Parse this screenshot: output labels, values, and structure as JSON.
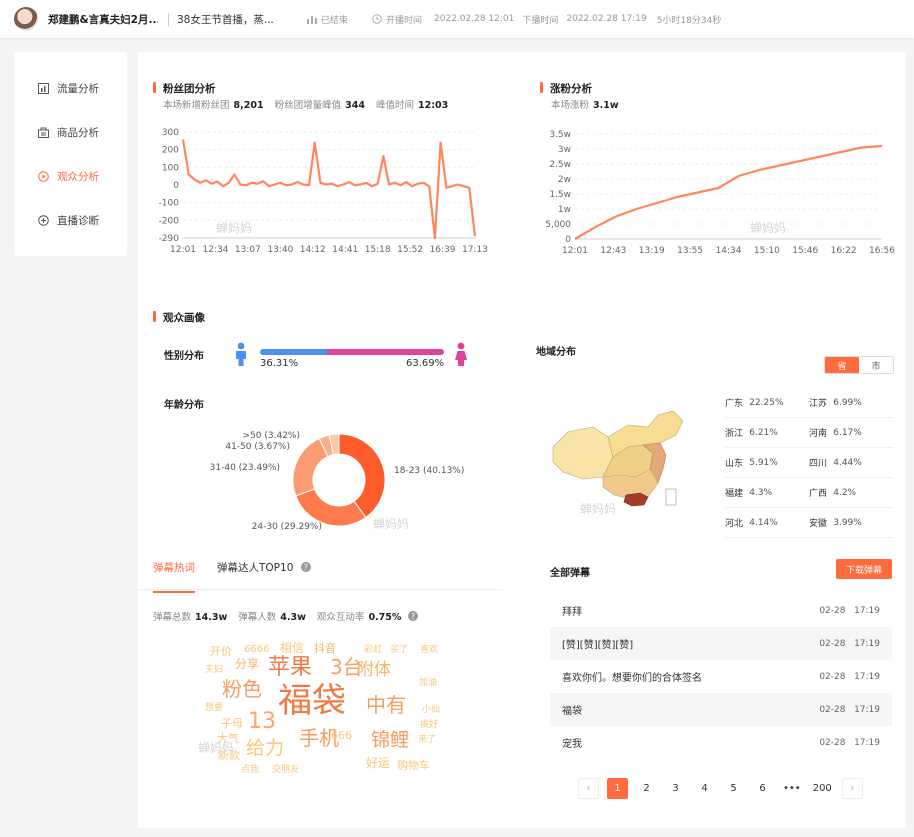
{
  "topbar": {
    "streamer": "郑建鹏&言真夫妇2月...",
    "room_title": "38女王节首播，蒸...",
    "status": "已结束",
    "start_label": "开播时间",
    "start_time": "2022.02.28 12:01",
    "end_label": "下播时间",
    "end_time": "2022.02.28 17:19",
    "duration": "5小时18分34秒"
  },
  "sidebar": {
    "items": [
      {
        "label": "流量分析",
        "icon": "bar-report-icon"
      },
      {
        "label": "商品分析",
        "icon": "goods-icon"
      },
      {
        "label": "观众分析",
        "icon": "play-circle-icon"
      },
      {
        "label": "直播诊断",
        "icon": "diagnose-icon"
      }
    ],
    "active_index": 2
  },
  "watermark": "蝉妈妈",
  "accent_color": "#ff6b3d",
  "fans": {
    "title": "粉丝团分析",
    "stats": [
      {
        "label": "本场新增粉丝团",
        "value": "8,201"
      },
      {
        "label": "粉丝团增量峰值",
        "value": "344"
      },
      {
        "label": "峰值时间",
        "value": "12:03"
      }
    ]
  },
  "growth": {
    "title": "涨粉分析",
    "stats": [
      {
        "label": "本场涨粉",
        "value": "3.1w"
      }
    ]
  },
  "chart_data": [
    {
      "type": "line",
      "ylabel": "",
      "xlabel": "",
      "x": [
        "12:01",
        "12:34",
        "13:07",
        "13:40",
        "14:12",
        "14:41",
        "15:18",
        "15:52",
        "16:39",
        "17:13"
      ],
      "yticks": [
        "300",
        "200",
        "100",
        "0",
        "-100",
        "-200",
        "-290"
      ],
      "ylim": [
        -290,
        344
      ],
      "series_values": [
        300,
        90,
        60,
        40,
        55,
        35,
        48,
        20,
        40,
        90,
        30,
        25,
        40,
        35,
        50,
        20,
        30,
        40,
        25,
        30,
        45,
        30,
        25,
        280,
        40,
        30,
        35,
        20,
        30,
        45,
        25,
        30,
        40,
        20,
        35,
        200,
        30,
        40,
        25,
        45,
        20,
        35,
        40,
        20,
        -290,
        280,
        10,
        20,
        30,
        20,
        10,
        -280
      ],
      "grid": true
    },
    {
      "type": "area",
      "ylabel": "",
      "xlabel": "",
      "x": [
        "12:01",
        "12:43",
        "13:19",
        "13:55",
        "14:34",
        "15:10",
        "15:46",
        "16:22",
        "16:56"
      ],
      "yticks": [
        "3.5w",
        "3w",
        "2.5w",
        "2w",
        "1.5w",
        "1w",
        "5,000",
        "0"
      ],
      "ylim": [
        0,
        35000
      ],
      "series_values": [
        0,
        4000,
        7500,
        10000,
        12000,
        14000,
        15500,
        17000,
        21000,
        23000,
        24500,
        26000,
        27500,
        29000,
        30500,
        31000
      ],
      "grid": true
    },
    {
      "type": "pie",
      "labels": [
        ">50 (3.42%)",
        "41-50 (3.67%)",
        "31-40 (23.49%)",
        "24-30 (29.29%)",
        "18-23 (40.13%)"
      ],
      "values": [
        3.42,
        3.67,
        23.49,
        29.29,
        40.13
      ],
      "colors": [
        "#fbc8a8",
        "#fab08a",
        "#fb9b74",
        "#ff7a4d",
        "#ff5c2b"
      ]
    }
  ],
  "audience": {
    "title": "观众画像",
    "gender_label": "性别分布",
    "male_pct": "36.31%",
    "female_pct": "63.69%",
    "male_value": 36.31,
    "male_color": "#4f8ef7",
    "female_color": "#e0439a",
    "age_label": "年龄分布",
    "region_label": "地域分布",
    "region_toggle": [
      "省",
      "市"
    ],
    "regions": [
      {
        "name": "广东",
        "value": "22.25%"
      },
      {
        "name": "江苏",
        "value": "6.99%"
      },
      {
        "name": "浙江",
        "value": "6.21%"
      },
      {
        "name": "河南",
        "value": "6.17%"
      },
      {
        "name": "山东",
        "value": "5.91%"
      },
      {
        "name": "四川",
        "value": "4.44%"
      },
      {
        "name": "福建",
        "value": "4.3%"
      },
      {
        "name": "广西",
        "value": "4.2%"
      },
      {
        "name": "河北",
        "value": "4.14%"
      },
      {
        "name": "安徽",
        "value": "3.99%"
      }
    ]
  },
  "danmu": {
    "tabs": [
      "弹幕热词",
      "弹幕达人TOP10"
    ],
    "stats": [
      {
        "label": "弹幕总数",
        "value": "14.3w"
      },
      {
        "label": "弹幕人数",
        "value": "4.3w"
      },
      {
        "label": "观众互动率",
        "value": "0.75%"
      }
    ],
    "words": [
      "福袋",
      "苹果",
      "3台",
      "粉色",
      "中有",
      "附体",
      "13",
      "手机",
      "锦鲤",
      "给力",
      "分享",
      "子母",
      "开价",
      "6666",
      "相信",
      "抖音",
      "666",
      "好运",
      "购物车",
      "加油",
      "大气",
      "新款",
      "点我",
      "交朋友",
      "想要",
      "夫妇",
      "买了",
      "来了",
      "小仙",
      "挨好",
      "喜欢",
      "彩虹"
    ],
    "all_title": "全部弹幕",
    "download": "下载弹幕",
    "items": [
      {
        "text": "拜拜",
        "date": "02-28",
        "time": "17:19"
      },
      {
        "text": "[赞][赞][赞][赞]",
        "date": "02-28",
        "time": "17:19"
      },
      {
        "text": "喜欢你们。想要你们的合体签名",
        "date": "02-28",
        "time": "17:19"
      },
      {
        "text": "福袋",
        "date": "02-28",
        "time": "17:19"
      },
      {
        "text": "宠我",
        "date": "02-28",
        "time": "17:19"
      }
    ],
    "pages": [
      "1",
      "2",
      "3",
      "4",
      "5",
      "6",
      "•••",
      "200"
    ],
    "current_page": "1"
  }
}
